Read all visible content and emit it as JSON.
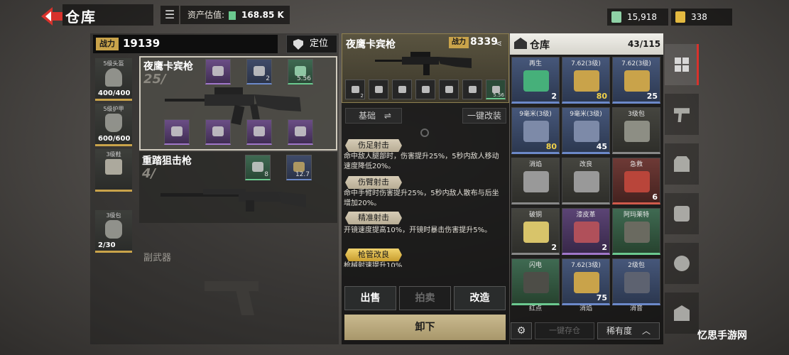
{
  "header": {
    "title": "仓库",
    "asset_label": "资产估值:",
    "asset_value": "168.85 K",
    "currency_cash": "15,918",
    "currency_gold": "338"
  },
  "loadout": {
    "power_label": "战力",
    "power_value": "19139",
    "locate_label": "定位",
    "gear": [
      {
        "level": "5级头盔",
        "durability": "400/400"
      },
      {
        "level": "5级护甲",
        "durability": "600/600"
      },
      {
        "level": "3级鞋",
        "durability": ""
      },
      {
        "level": "3级包",
        "durability": "2/30"
      }
    ],
    "primary": {
      "name": "夜鹰卡宾枪",
      "ammo": "25/",
      "attachment_values": [
        "",
        "2",
        "5.56"
      ]
    },
    "secondary": {
      "name": "重踏狙击枪",
      "ammo": "4/",
      "attachment_values": [
        "8",
        "12.7"
      ]
    },
    "sidearm_label": "副武器"
  },
  "detail": {
    "weapon_name": "夜鹰卡宾枪",
    "power_label": "战力",
    "power_value": "8339",
    "mini_attachments": [
      "2",
      "",
      "",
      "",
      "",
      "",
      "5.56"
    ],
    "mode_label": "基础",
    "onekey_label": "一键改装",
    "perks": [
      {
        "name": "伤足射击",
        "desc": "命中敌人腿部时，伤害提升25%，5秒内敌人移动速度降低20%。"
      },
      {
        "name": "伤臂射击",
        "desc": "命中手臂时伤害提升25%，5秒内敌人散布与后坐增加20%。"
      },
      {
        "name": "精准射击",
        "desc": "开镜速度提高10%，开镜时暴击伤害提升5%。"
      },
      {
        "name": "枪管改良",
        "desc": "枪械射速提升10%"
      }
    ],
    "sell_label": "出售",
    "auction_label": "拍卖",
    "modify_label": "改造",
    "unload_label": "卸下"
  },
  "warehouse": {
    "title": "仓库",
    "count": "43/115",
    "cells": [
      {
        "label": "再生",
        "qty": "2",
        "color": "blue",
        "highlight": false,
        "bottom": ""
      },
      {
        "label": "7.62(3级)",
        "qty": "80",
        "color": "blue",
        "highlight": true,
        "bottom": ""
      },
      {
        "label": "7.62(3级)",
        "qty": "25",
        "color": "blue",
        "highlight": false,
        "bottom": ""
      },
      {
        "label": "9毫米(3级)",
        "qty": "80",
        "color": "blue",
        "highlight": true,
        "bottom": ""
      },
      {
        "label": "9毫米(3级)",
        "qty": "45",
        "color": "blue",
        "highlight": false,
        "bottom": ""
      },
      {
        "label": "3级包",
        "qty": "",
        "color": "grey",
        "highlight": false,
        "bottom": ""
      },
      {
        "label": "消焰",
        "qty": "",
        "color": "grey",
        "highlight": false,
        "bottom": ""
      },
      {
        "label": "改良",
        "qty": "",
        "color": "grey",
        "highlight": false,
        "bottom": ""
      },
      {
        "label": "急救",
        "qty": "6",
        "color": "red",
        "highlight": false,
        "bottom": ""
      },
      {
        "label": "破铜",
        "qty": "2",
        "color": "grey",
        "highlight": false,
        "bottom": ""
      },
      {
        "label": "漆皮革",
        "qty": "2",
        "color": "purple",
        "highlight": false,
        "bottom": ""
      },
      {
        "label": "阿玛莱特",
        "qty": "",
        "color": "green",
        "highlight": false,
        "bottom": ""
      },
      {
        "label": "闪电",
        "qty": "",
        "color": "green",
        "highlight": false,
        "bottom": "红点"
      },
      {
        "label": "7.62(3级)",
        "qty": "75",
        "color": "blue",
        "highlight": false,
        "bottom": "消焰"
      },
      {
        "label": "2级包",
        "qty": "",
        "color": "blue",
        "highlight": false,
        "bottom": "消音"
      }
    ],
    "stack_label": "一键存仓",
    "sort_label": "稀有度"
  },
  "watermark": "忆思手游网",
  "colors": {
    "accent_red": "#d8322c",
    "gold": "#c9a34a",
    "blue": "#6c89c9",
    "green": "#6bc98f",
    "purple": "#a077c9"
  }
}
